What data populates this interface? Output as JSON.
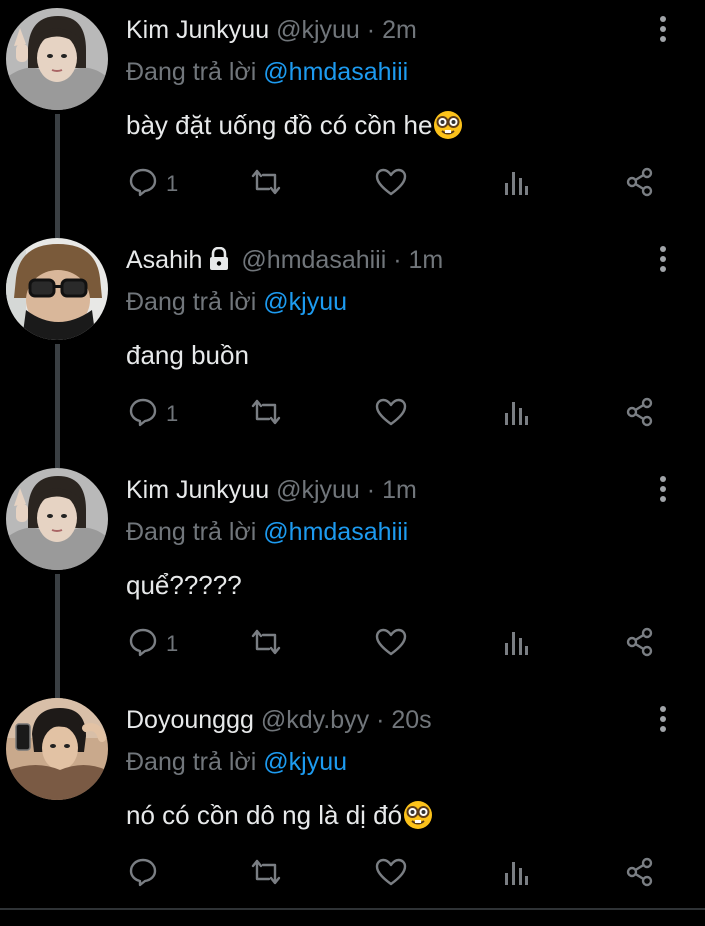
{
  "tweets": [
    {
      "name": "Kim Junkyuu",
      "locked": false,
      "handle": "@kjyuu",
      "time": "2m",
      "reply_prefix": "Đang trả lời",
      "reply_to": "@hmdasahiii",
      "text": "bày đặt uống đồ có cồn he",
      "emoji": "nerd-face",
      "reply_count": "1",
      "avatar": "junkyuu"
    },
    {
      "name": "Asahih",
      "locked": true,
      "handle": "@hmdasahiii",
      "time": "1m",
      "reply_prefix": "Đang trả lời",
      "reply_to": "@kjyuu",
      "text": "đang buồn",
      "emoji": null,
      "reply_count": "1",
      "avatar": "asahi"
    },
    {
      "name": "Kim Junkyuu",
      "locked": false,
      "handle": "@kjyuu",
      "time": "1m",
      "reply_prefix": "Đang trả lời",
      "reply_to": "@hmdasahiii",
      "text": "quể?????",
      "emoji": null,
      "reply_count": "1",
      "avatar": "junkyuu"
    },
    {
      "name": "Doyounggg",
      "locked": false,
      "handle": "@kdy.byy",
      "time": "20s",
      "reply_prefix": "Đang trả lời",
      "reply_to": "@kjyuu",
      "text": "nó có cồn dô ng là dị đó",
      "emoji": "nerd-face",
      "reply_count": "",
      "avatar": "doyoung"
    }
  ],
  "separator": "·",
  "colors": {
    "background": "#000000",
    "text": "#e7e9ea",
    "muted": "#71767b",
    "link": "#1d9bf0",
    "thread_line": "#3a3f43"
  },
  "icons": [
    "lock-icon",
    "more-vertical-icon",
    "reply-icon",
    "retweet-icon",
    "like-icon",
    "analytics-icon",
    "share-icon"
  ]
}
